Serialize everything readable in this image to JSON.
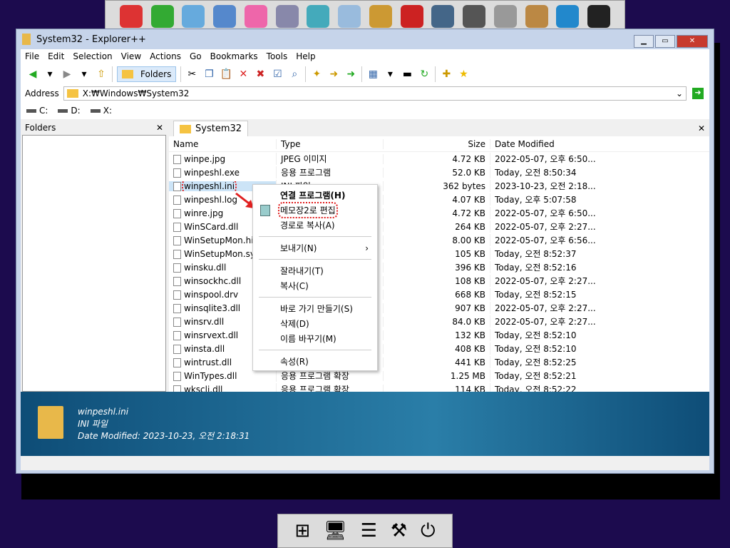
{
  "window": {
    "title": "System32 - Explorer++"
  },
  "menu": [
    "File",
    "Edit",
    "Selection",
    "View",
    "Actions",
    "Go",
    "Bookmarks",
    "Tools",
    "Help"
  ],
  "toolbar": {
    "folders_label": "Folders"
  },
  "address": {
    "label": "Address",
    "value": "X:₩Windows₩System32"
  },
  "drives": [
    "C:",
    "D:",
    "X:"
  ],
  "folders_pane": {
    "title": "Folders"
  },
  "tab": {
    "label": "System32"
  },
  "columns": [
    "Name",
    "Type",
    "Size",
    "Date Modified"
  ],
  "files": [
    {
      "name": "winpe.jpg",
      "type": "JPEG 이미지",
      "size": "4.72 KB",
      "date": "2022-05-07, 오후 6:50..."
    },
    {
      "name": "winpeshl.exe",
      "type": "응용 프로그램",
      "size": "52.0 KB",
      "date": "Today, 오전 8:50:34"
    },
    {
      "name": "winpeshl.ini",
      "type": "INI 파일",
      "size": "362 bytes",
      "date": "2023-10-23, 오전 2:18..."
    },
    {
      "name": "winpeshl.log",
      "type": "",
      "size": "4.07 KB",
      "date": "Today, 오후 5:07:58"
    },
    {
      "name": "winre.jpg",
      "type": "",
      "size": "4.72 KB",
      "date": "2022-05-07, 오후 6:50..."
    },
    {
      "name": "WinSCard.dll",
      "type": "",
      "size": "264 KB",
      "date": "2022-05-07, 오후 2:27..."
    },
    {
      "name": "WinSetupMon.hiv",
      "type": "",
      "size": "8.00 KB",
      "date": "2022-05-07, 오후 6:56..."
    },
    {
      "name": "WinSetupMon.sys",
      "type": "",
      "size": "105 KB",
      "date": "Today, 오전 8:52:37"
    },
    {
      "name": "winsku.dll",
      "type": "",
      "size": "396 KB",
      "date": "Today, 오전 8:52:16"
    },
    {
      "name": "winsockhc.dll",
      "type": "",
      "size": "108 KB",
      "date": "2022-05-07, 오후 2:27..."
    },
    {
      "name": "winspool.drv",
      "type": "",
      "size": "668 KB",
      "date": "Today, 오전 8:52:15"
    },
    {
      "name": "winsqlite3.dll",
      "type": "",
      "size": "907 KB",
      "date": "2022-05-07, 오후 2:27..."
    },
    {
      "name": "winsrv.dll",
      "type": "",
      "size": "84.0 KB",
      "date": "2022-05-07, 오후 2:27..."
    },
    {
      "name": "winsrvext.dll",
      "type": "",
      "size": "132 KB",
      "date": "Today, 오전 8:52:10"
    },
    {
      "name": "winsta.dll",
      "type": "",
      "size": "408 KB",
      "date": "Today, 오전 8:52:10"
    },
    {
      "name": "wintrust.dll",
      "type": "",
      "size": "441 KB",
      "date": "Today, 오전 8:52:25"
    },
    {
      "name": "WinTypes.dll",
      "type": "응용 프로그램 확장",
      "size": "1.25 MB",
      "date": "Today, 오전 8:52:21"
    },
    {
      "name": "wkscli.dll",
      "type": "응용 프로그램 확장",
      "size": "114 KB",
      "date": "Today, 오전 8:52:22"
    }
  ],
  "context_menu": [
    {
      "label": "연결 프로그램(H)",
      "bold": true
    },
    {
      "label": "메모장2로 편집",
      "icon": "notepad-icon"
    },
    {
      "label": "경로로 복사(A)"
    },
    {
      "sep": true
    },
    {
      "label": "보내기(N)",
      "submenu": true
    },
    {
      "sep": true
    },
    {
      "label": "잘라내기(T)"
    },
    {
      "label": "복사(C)"
    },
    {
      "sep": true
    },
    {
      "label": "바로 가기 만들기(S)"
    },
    {
      "label": "삭제(D)"
    },
    {
      "label": "이름 바꾸기(M)"
    },
    {
      "sep": true
    },
    {
      "label": "속성(R)"
    }
  ],
  "info": {
    "name": "winpeshl.ini",
    "type": "INI 파일",
    "modified": "Date Modified: 2023-10-23, 오전 2:18:31"
  },
  "colors": {
    "background": "#1c0b4e",
    "selection": "#cce4f7",
    "highlight": "#e02020",
    "info_panel": "#2a7ea8"
  }
}
